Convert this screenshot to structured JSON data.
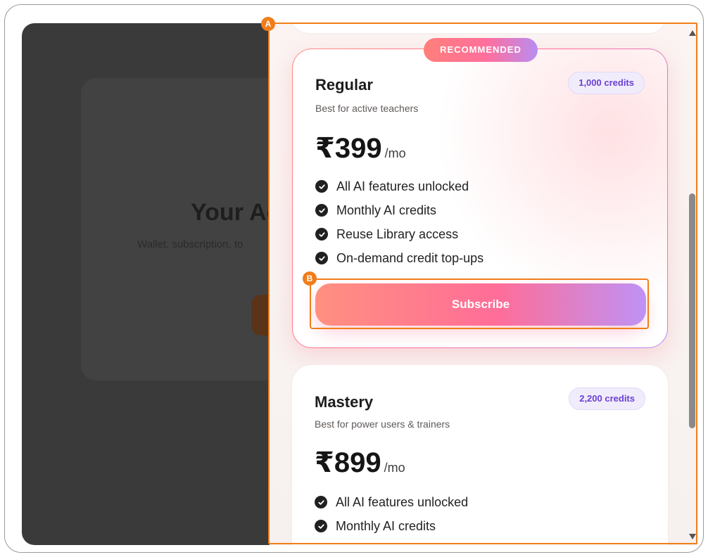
{
  "background_page": {
    "title": "Your Ac",
    "subtitle": "Wallet, subscription, to"
  },
  "annotations": {
    "a": "A",
    "b": "B"
  },
  "plans": {
    "regular": {
      "badge": "RECOMMENDED",
      "name": "Regular",
      "subtitle": "Best for active teachers",
      "credits": "1,000 credits",
      "price": "₹399",
      "period": "/mo",
      "features": [
        "All AI features unlocked",
        "Monthly AI credits",
        "Reuse Library access",
        "On-demand credit top-ups"
      ],
      "cta": "Subscribe"
    },
    "mastery": {
      "name": "Mastery",
      "subtitle": "Best for power users & trainers",
      "credits": "2,200 credits",
      "price": "₹899",
      "period": "/mo",
      "features": [
        "All AI features unlocked",
        "Monthly AI credits"
      ]
    }
  },
  "colors": {
    "accent_orange": "#f07d1a",
    "gradient_start": "#ff8a80",
    "gradient_mid": "#ff6f9a",
    "gradient_end": "#b38cf5",
    "credits_text": "#6a3fd1"
  },
  "icons": {
    "feature_check": "check-circle-icon",
    "scroll_up": "triangle-up-icon",
    "scroll_down": "triangle-down-icon"
  }
}
